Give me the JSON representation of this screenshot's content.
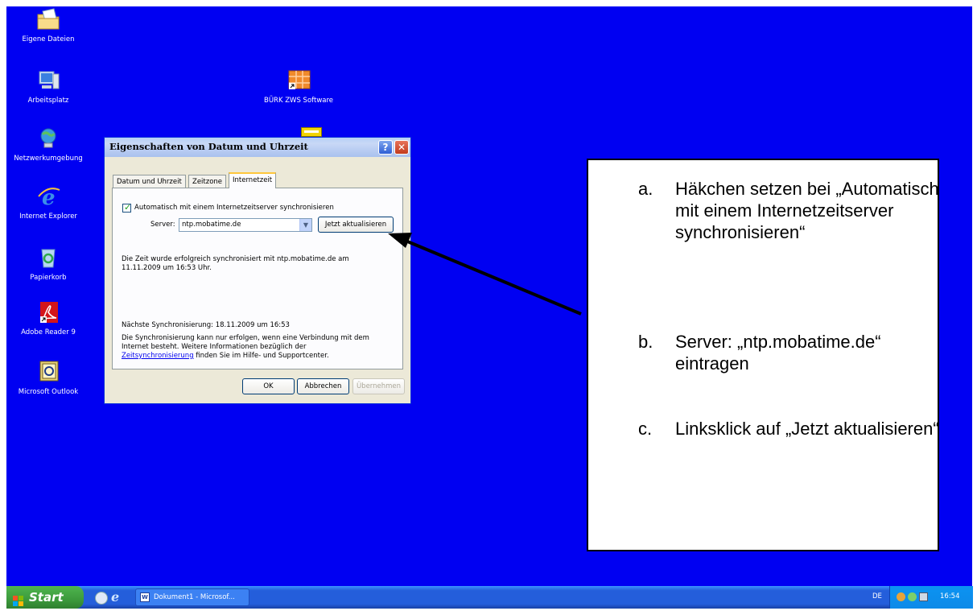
{
  "desktop": {
    "icons": [
      {
        "label": "Eigene Dateien",
        "icon": "folder-icon"
      },
      {
        "label": "Arbeitsplatz",
        "icon": "computer-icon"
      },
      {
        "label": "Netzwerkumgebung",
        "icon": "network-icon"
      },
      {
        "label": "Internet Explorer",
        "icon": "ie-icon"
      },
      {
        "label": "Papierkorb",
        "icon": "recycle-bin-icon"
      },
      {
        "label": "Adobe Reader 9",
        "icon": "adobe-reader-icon"
      },
      {
        "label": "Microsoft Outlook",
        "icon": "outlook-icon"
      },
      {
        "label": "BÜRK ZWS Software",
        "icon": "buerk-zws-icon"
      }
    ]
  },
  "dialog": {
    "title": "Eigenschaften von Datum und Uhrzeit",
    "help_glyph": "?",
    "close_glyph": "✕",
    "tabs": [
      "Datum und Uhrzeit",
      "Zeitzone",
      "Internetzeit"
    ],
    "active_tab": "Internetzeit",
    "auto_sync_label": "Automatisch mit einem Internetzeitserver synchronisieren",
    "auto_sync_checked": true,
    "server_label": "Server:",
    "server_value": "ntp.mobatime.de",
    "update_button": "Jetzt aktualisieren",
    "status_line1": "Die Zeit wurde erfolgreich synchronisiert mit ntp.mobatime.de am",
    "status_line2": "11.11.2009 um 16:53 Uhr.",
    "next_sync": "Nächste Synchronisierung: 18.11.2009 um 16:53",
    "info_line1": "Die Synchronisierung kann nur erfolgen, wenn eine Verbindung mit dem",
    "info_line2": "Internet besteht. Weitere Informationen bezüglich der",
    "info_link": "Zeitsynchronisierung",
    "info_line3_rest": " finden Sie im Hilfe- und Supportcenter.",
    "ok_button": "OK",
    "cancel_button": "Abbrechen",
    "apply_button": "Übernehmen"
  },
  "instructions": [
    {
      "letter": "a.",
      "text": "Häkchen setzen bei „Automatisch mit einem Internetzeitserver synchronisieren“"
    },
    {
      "letter": "b.",
      "text": "Server: „ntp.mobatime.de“ eintragen"
    },
    {
      "letter": "c.",
      "text": "Linksklick auf „Jetzt aktualisieren“"
    }
  ],
  "taskbar": {
    "start_label": "Start",
    "task_label": "Dokument1 - Microsof...",
    "language": "DE",
    "clock": "16:54"
  },
  "colors": {
    "desktop_bg": "#0000f2",
    "taskbar_blue": "#245edb",
    "start_green": "#3c9a3c"
  }
}
